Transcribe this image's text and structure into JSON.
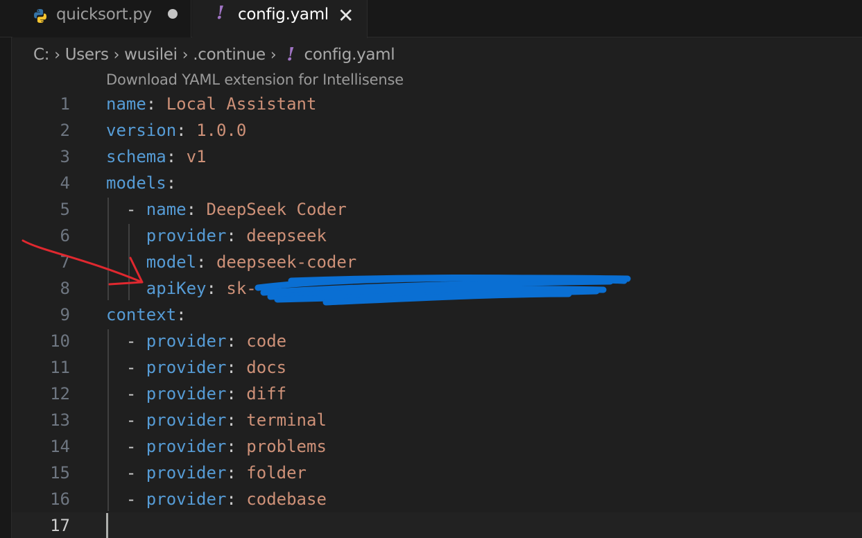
{
  "tabs": [
    {
      "label": "quicksort.py",
      "icon": "python-icon",
      "modified": true
    },
    {
      "label": "config.yaml",
      "icon": "yaml-icon",
      "active": true
    }
  ],
  "breadcrumb": [
    "C:",
    "Users",
    "wusilei",
    ".continue",
    "config.yaml"
  ],
  "codelens": "Download YAML extension for Intellisense",
  "lines": [
    {
      "n": "1",
      "key": "name",
      "val": "Local Assistant"
    },
    {
      "n": "2",
      "key": "version",
      "val": "1.0.0"
    },
    {
      "n": "3",
      "key": "schema",
      "val": "v1"
    },
    {
      "n": "4",
      "key": "models",
      "val": ""
    },
    {
      "n": "5",
      "key": "name",
      "val": "DeepSeek Coder"
    },
    {
      "n": "6",
      "key": "provider",
      "val": "deepseek"
    },
    {
      "n": "7",
      "key": "model",
      "val": "deepseek-coder"
    },
    {
      "n": "8",
      "key": "apiKey",
      "val": "sk-"
    },
    {
      "n": "9",
      "key": "context",
      "val": ""
    },
    {
      "n": "10",
      "key": "provider",
      "val": "code"
    },
    {
      "n": "11",
      "key": "provider",
      "val": "docs"
    },
    {
      "n": "12",
      "key": "provider",
      "val": "diff"
    },
    {
      "n": "13",
      "key": "provider",
      "val": "terminal"
    },
    {
      "n": "14",
      "key": "provider",
      "val": "problems"
    },
    {
      "n": "15",
      "key": "provider",
      "val": "folder"
    },
    {
      "n": "16",
      "key": "provider",
      "val": "codebase"
    },
    {
      "n": "17",
      "key": "",
      "val": ""
    }
  ],
  "colors": {
    "key": "#569cd6",
    "value": "#ce9178",
    "annotation_arrow": "#e0282f",
    "scribble": "#0a6fd3"
  }
}
